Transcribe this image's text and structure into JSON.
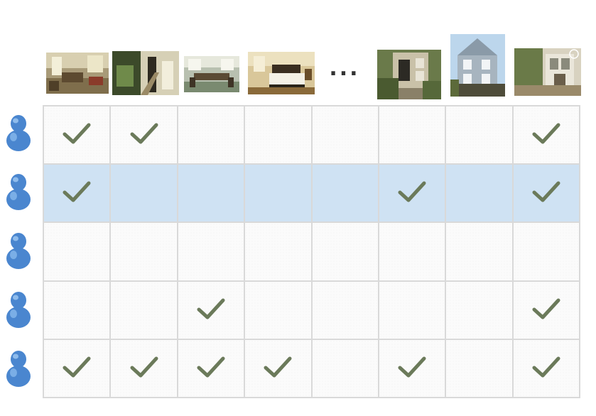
{
  "columns": [
    {
      "label": "living-room-photo",
      "ellipsis_before": false
    },
    {
      "label": "staircase-photo",
      "ellipsis_before": false
    },
    {
      "label": "dining-room-photo",
      "ellipsis_before": false
    },
    {
      "label": "bedroom-photo",
      "ellipsis_before": false
    },
    {
      "label": "",
      "ellipsis_before": false
    },
    {
      "label": "house-entrance-photo",
      "ellipsis_before": false
    },
    {
      "label": "victorian-house-photo",
      "ellipsis_before": false
    },
    {
      "label": "house-facade-photo",
      "ellipsis_before": false
    }
  ],
  "ellipsis": "...",
  "users": [
    {
      "icon": "user-icon",
      "highlighted": false,
      "checks": [
        true,
        true,
        false,
        false,
        false,
        false,
        false,
        true
      ]
    },
    {
      "icon": "user-icon",
      "highlighted": true,
      "checks": [
        true,
        false,
        false,
        false,
        false,
        true,
        false,
        true
      ]
    },
    {
      "icon": "user-icon",
      "highlighted": false,
      "checks": [
        false,
        false,
        false,
        false,
        false,
        false,
        false,
        false
      ]
    },
    {
      "icon": "user-icon",
      "highlighted": false,
      "checks": [
        false,
        false,
        true,
        false,
        false,
        false,
        false,
        true
      ]
    },
    {
      "icon": "user-icon",
      "highlighted": false,
      "checks": [
        true,
        true,
        true,
        true,
        false,
        true,
        false,
        true
      ]
    }
  ],
  "colors": {
    "check": "#6b7a5a",
    "highlight_row": "#cfe2f3",
    "grid_line": "#d9d9d9",
    "user_icon": "#4a86cf"
  }
}
